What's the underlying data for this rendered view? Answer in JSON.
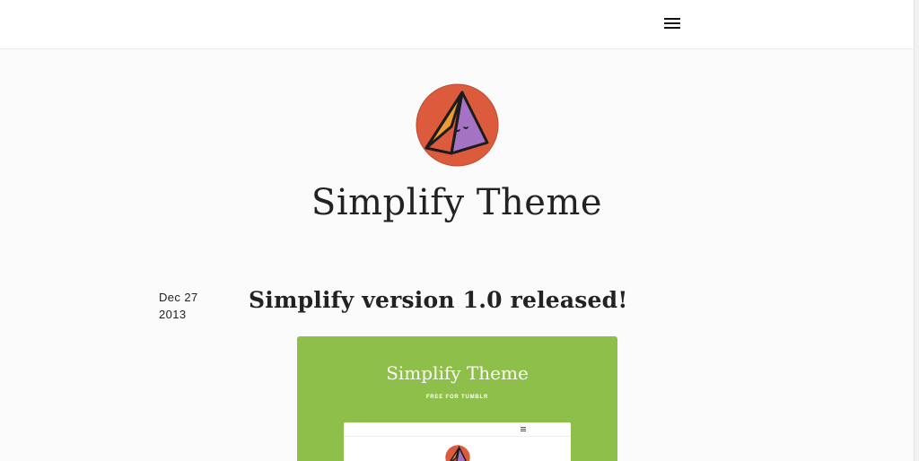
{
  "header": {
    "menu_icon": "hamburger-menu-icon"
  },
  "site": {
    "logo_icon": "pyramid-logo-icon",
    "title": "Simplify Theme"
  },
  "post": {
    "date_month_day": "Dec 27",
    "date_year": "2013",
    "title": "Simplify version 1.0 released!",
    "image": {
      "title": "Simplify Theme",
      "subtitle": "FREE FOR TUMBLR"
    }
  },
  "colors": {
    "accent_green": "#8ebf4a",
    "logo_circle": "#dd5b3d",
    "logo_left_face": "#f09b32",
    "logo_right_face": "#a573c4"
  }
}
